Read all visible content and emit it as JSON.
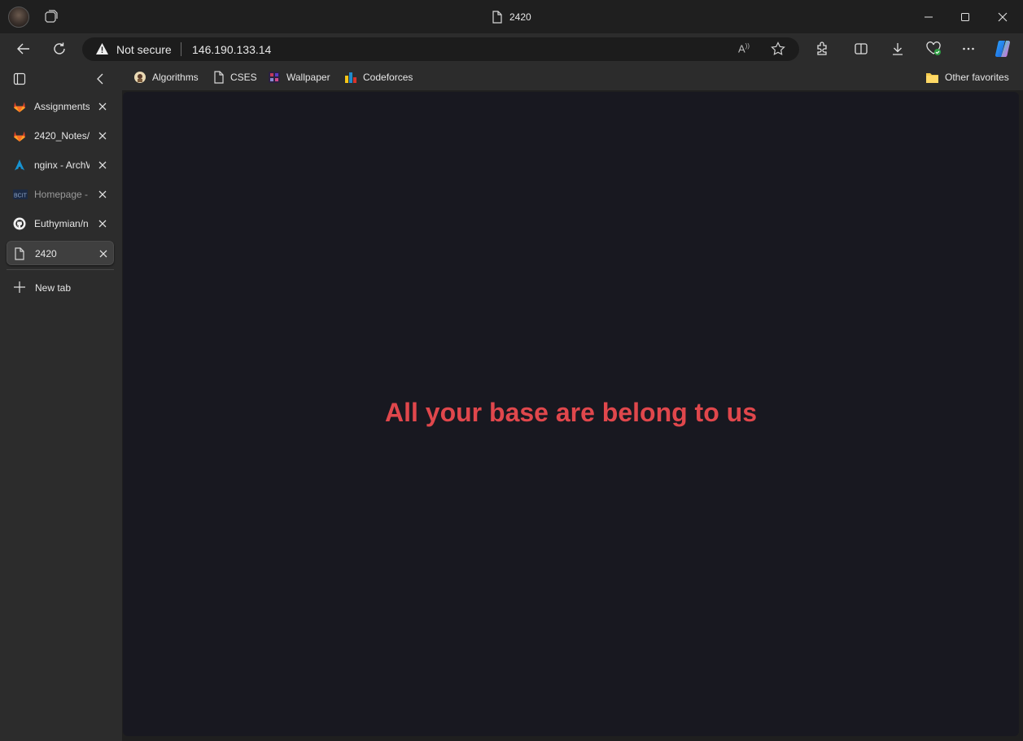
{
  "window": {
    "title": "2420",
    "controls": {
      "minimize": "minimize-icon",
      "maximize": "maximize-icon",
      "close": "close-icon"
    }
  },
  "toolbar": {
    "security_label": "Not secure",
    "url": "146.190.133.14",
    "read_aloud": "A",
    "icons": [
      "back-icon",
      "refresh-icon",
      "favorite-star-icon",
      "extensions-icon",
      "split-screen-icon",
      "downloads-icon",
      "browser-essentials-icon",
      "more-icon",
      "copilot-icon"
    ]
  },
  "favorites": {
    "items": [
      {
        "label": "Algorithms",
        "icon": "algorithms-favicon"
      },
      {
        "label": "CSES",
        "icon": "page-icon"
      },
      {
        "label": "Wallpaper",
        "icon": "wallpaper-favicon"
      },
      {
        "label": "Codeforces",
        "icon": "codeforces-favicon"
      }
    ],
    "other": "Other favorites"
  },
  "tabs": [
    {
      "label": "Assignments",
      "icon": "gitlab-icon",
      "active": false
    },
    {
      "label": "2420_Notes/",
      "icon": "gitlab-icon",
      "active": false
    },
    {
      "label": "nginx - ArchW",
      "icon": "arch-icon",
      "active": false
    },
    {
      "label": "Homepage -",
      "icon": "bcit-icon",
      "active": false
    },
    {
      "label": "Euthymian/n",
      "icon": "github-icon",
      "active": false
    },
    {
      "label": "2420",
      "icon": "page-icon",
      "active": true
    }
  ],
  "new_tab_label": "New tab",
  "page": {
    "heading": "All your base are belong to us",
    "heading_color": "#e0474c",
    "background": "#181820"
  }
}
